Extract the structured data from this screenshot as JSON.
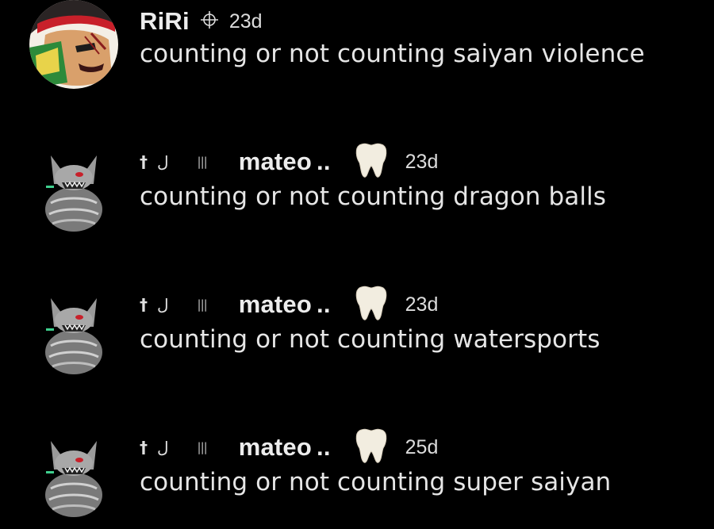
{
  "comments": [
    {
      "username": "RiRi",
      "badge_icon": "crosshair-icon",
      "time": "23d",
      "text": "counting or not counting saiyan violence",
      "avatar": "warrior-avatar"
    },
    {
      "prefix_dagger": "†",
      "prefix_hook": "ل",
      "prefix_bars": "|||",
      "username": "mateo",
      "dots": "..",
      "badge_icon": "tooth-icon",
      "time": "23d",
      "text": "counting or not counting dragon balls",
      "avatar": "creature-avatar"
    },
    {
      "prefix_dagger": "†",
      "prefix_hook": "ل",
      "prefix_bars": "|||",
      "username": "mateo",
      "dots": "..",
      "badge_icon": "tooth-icon",
      "time": "23d",
      "text": "counting or not counting watersports",
      "avatar": "creature-avatar"
    },
    {
      "prefix_dagger": "†",
      "prefix_hook": "ل",
      "prefix_bars": "|||",
      "username": "mateo",
      "dots": "..",
      "badge_icon": "tooth-icon",
      "time": "25d",
      "text": "counting or not counting super saiyan",
      "avatar": "creature-avatar"
    }
  ]
}
